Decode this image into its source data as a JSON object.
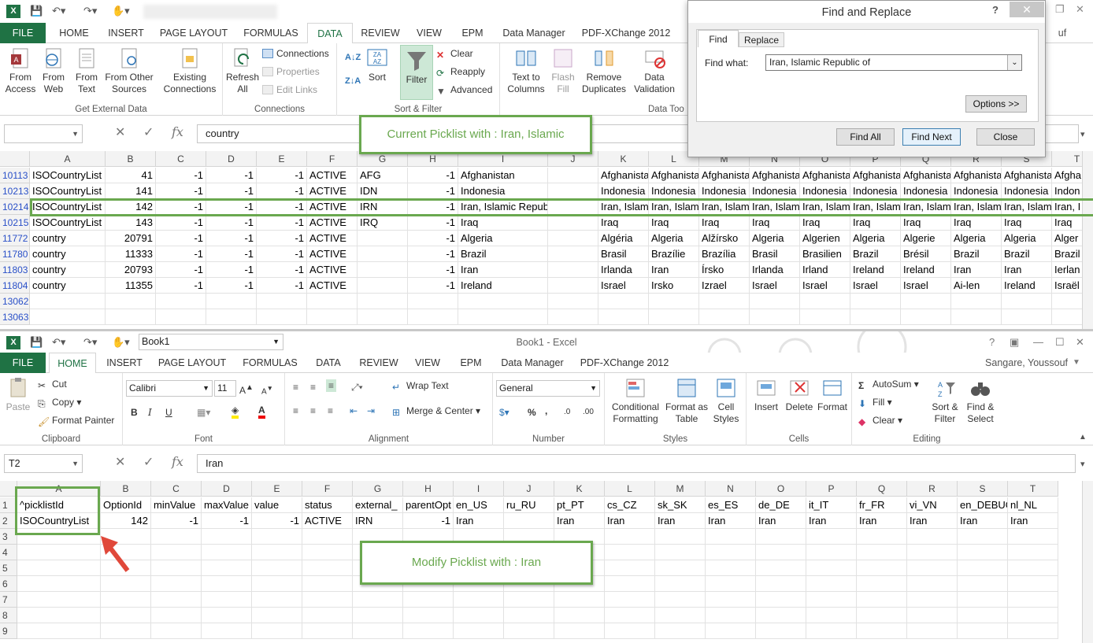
{
  "top_window": {
    "tabs": [
      "FILE",
      "HOME",
      "INSERT",
      "PAGE LAYOUT",
      "FORMULAS",
      "DATA",
      "REVIEW",
      "VIEW",
      "EPM",
      "Data Manager",
      "PDF-XChange 2012"
    ],
    "active_tab": "DATA",
    "user_partial": "uf",
    "ribbon": {
      "get_external": {
        "label": "Get External Data",
        "from_access": "From\nAccess",
        "from_web": "From\nWeb",
        "from_text": "From\nText",
        "from_other": "From Other\nSources",
        "existing": "Existing\nConnections"
      },
      "connections": {
        "label": "Connections",
        "refresh_all": "Refresh\nAll",
        "connections": "Connections",
        "properties": "Properties",
        "edit_links": "Edit Links"
      },
      "sort_filter": {
        "label": "Sort & Filter",
        "sort": "Sort",
        "filter": "Filter",
        "clear": "Clear",
        "reapply": "Reapply",
        "advanced": "Advanced"
      },
      "data_tools": {
        "label": "Data Too",
        "text_to_columns": "Text to\nColumns",
        "flash_fill": "Flash\nFill",
        "remove_duplicates": "Remove\nDuplicates",
        "data_validation": "Data\nValidation"
      }
    },
    "formula": {
      "name_box": "",
      "value": "country"
    },
    "columns": [
      "A",
      "B",
      "C",
      "D",
      "E",
      "F",
      "G",
      "H",
      "I",
      "J",
      "K",
      "L",
      "M",
      "N",
      "O",
      "P",
      "Q",
      "R",
      "S",
      "T"
    ],
    "rows": [
      {
        "num": "10113",
        "cells": [
          "ISOCountryList",
          "41",
          "-1",
          "-1",
          "-1",
          "ACTIVE",
          "AFG",
          "-1",
          "Afghanistan",
          "",
          "Afghanista",
          "Afghanista",
          "Afghanista",
          "Afghanista",
          "Afghanista",
          "Afghanista",
          "Afghanista",
          "Afghanista",
          "Afghanista",
          "Afgha"
        ]
      },
      {
        "num": "10213",
        "cells": [
          "ISOCountryList",
          "141",
          "-1",
          "-1",
          "-1",
          "ACTIVE",
          "IDN",
          "-1",
          "Indonesia",
          "",
          "Indonesia",
          "Indonesia",
          "Indonesia",
          "Indonesia",
          "Indonesia",
          "Indonesia",
          "Indonesia",
          "Indonesia",
          "Indonesia",
          "Indon"
        ]
      },
      {
        "num": "10214",
        "cells": [
          "ISOCountryList",
          "142",
          "-1",
          "-1",
          "-1",
          "ACTIVE",
          "IRN",
          "-1",
          "Iran, Islamic Republic of",
          "",
          "Iran, Islam",
          "Iran, Islam",
          "Iran, Islam",
          "Iran, Islam",
          "Iran, Islam",
          "Iran, Islam",
          "Iran, Islam",
          "Iran, Islam",
          "Iran, Islam",
          "Iran, I"
        ]
      },
      {
        "num": "10215",
        "cells": [
          "ISOCountryList",
          "143",
          "-1",
          "-1",
          "-1",
          "ACTIVE",
          "IRQ",
          "-1",
          "Iraq",
          "",
          "Iraq",
          "Iraq",
          "Iraq",
          "Iraq",
          "Iraq",
          "Iraq",
          "Iraq",
          "Iraq",
          "Iraq",
          "Iraq"
        ]
      },
      {
        "num": "11772",
        "cells": [
          "country",
          "20791",
          "-1",
          "-1",
          "-1",
          "ACTIVE",
          "",
          "-1",
          "Algeria",
          "",
          "Algéria",
          "Algeria",
          "Alžírsko",
          "Algeria",
          "Algerien",
          "Algeria",
          "Algerie",
          "Algeria",
          "Algeria",
          "Alger"
        ]
      },
      {
        "num": "11780",
        "cells": [
          "country",
          "11333",
          "-1",
          "-1",
          "-1",
          "ACTIVE",
          "",
          "-1",
          "Brazil",
          "",
          "Brasil",
          "Brazílie",
          "Brazília",
          "Brasil",
          "Brasilien",
          "Brazil",
          "Brésil",
          "Brazil",
          "Brazil",
          "Brazil"
        ]
      },
      {
        "num": "11803",
        "cells": [
          "country",
          "20793",
          "-1",
          "-1",
          "-1",
          "ACTIVE",
          "",
          "-1",
          "Iran",
          "",
          "Irlanda",
          "Iran",
          "Írsko",
          "Irlanda",
          "Irland",
          "Ireland",
          "Ireland",
          "Iran",
          "Iran",
          "Ierlan"
        ]
      },
      {
        "num": "11804",
        "cells": [
          "country",
          "11355",
          "-1",
          "-1",
          "-1",
          "ACTIVE",
          "",
          "-1",
          "Ireland",
          "",
          "Israel",
          "Irsko",
          "Izrael",
          "Israel",
          "Israel",
          "Israel",
          "Israel",
          "Ai-len",
          "Ireland",
          "Israël"
        ]
      },
      {
        "num": "13062",
        "cells": []
      },
      {
        "num": "13063",
        "cells": []
      }
    ],
    "callout": "Current Picklist with : Iran, Islamic"
  },
  "find_replace": {
    "title": "Find and Replace",
    "help": "?",
    "close": "✕",
    "tab_find": "Find",
    "tab_replace": "Replace",
    "find_what_label": "Find what:",
    "find_what_value": "Iran, Islamic Republic of",
    "options": "Options >>",
    "find_all": "Find All",
    "find_next": "Find Next",
    "close_btn": "Close"
  },
  "bottom_window": {
    "name_box_top": "Book1",
    "title": "Book1 - Excel",
    "user": "Sangare, Youssouf",
    "tabs": [
      "FILE",
      "HOME",
      "INSERT",
      "PAGE LAYOUT",
      "FORMULAS",
      "DATA",
      "REVIEW",
      "VIEW",
      "EPM",
      "Data Manager",
      "PDF-XChange 2012"
    ],
    "active_tab": "HOME",
    "ribbon": {
      "clipboard": {
        "label": "Clipboard",
        "paste": "Paste",
        "cut": "Cut",
        "copy": "Copy",
        "format_painter": "Format Painter"
      },
      "font": {
        "label": "Font",
        "name": "Calibri",
        "size": "11",
        "bold": "B",
        "italic": "I",
        "underline": "U"
      },
      "alignment": {
        "label": "Alignment",
        "wrap_text": "Wrap Text",
        "merge_center": "Merge & Center"
      },
      "number": {
        "label": "Number",
        "format": "General",
        "percent": "%",
        "comma": ","
      },
      "styles": {
        "label": "Styles",
        "conditional": "Conditional\nFormatting",
        "format_table": "Format as\nTable",
        "cell_styles": "Cell\nStyles"
      },
      "cells": {
        "label": "Cells",
        "insert": "Insert",
        "delete": "Delete",
        "format": "Format"
      },
      "editing": {
        "label": "Editing",
        "autosum": "AutoSum",
        "fill": "Fill",
        "clear": "Clear",
        "sort_filter": "Sort &\nFilter",
        "find_select": "Find &\nSelect"
      }
    },
    "formula": {
      "name_box": "T2",
      "value": "Iran"
    },
    "columns": [
      "A",
      "B",
      "C",
      "D",
      "E",
      "F",
      "G",
      "H",
      "I",
      "J",
      "K",
      "L",
      "M",
      "N",
      "O",
      "P",
      "Q",
      "R",
      "S",
      "T"
    ],
    "rows": [
      {
        "num": "1",
        "cells": [
          "^picklistId",
          "OptionId",
          "minValue",
          "maxValue",
          "value",
          "status",
          "external_",
          "parentOpt",
          "en_US",
          "ru_RU",
          "pt_PT",
          "cs_CZ",
          "sk_SK",
          "es_ES",
          "de_DE",
          "it_IT",
          "fr_FR",
          "vi_VN",
          "en_DEBUG",
          "nl_NL"
        ]
      },
      {
        "num": "2",
        "cells": [
          "ISOCountryList",
          "142",
          "-1",
          "-1",
          "-1",
          "ACTIVE",
          "IRN",
          "-1",
          "Iran",
          "",
          "Iran",
          "Iran",
          "Iran",
          "Iran",
          "Iran",
          "Iran",
          "Iran",
          "Iran",
          "Iran",
          "Iran"
        ]
      },
      {
        "num": "3",
        "cells": []
      },
      {
        "num": "4",
        "cells": []
      },
      {
        "num": "5",
        "cells": []
      },
      {
        "num": "6",
        "cells": []
      },
      {
        "num": "7",
        "cells": []
      },
      {
        "num": "8",
        "cells": []
      },
      {
        "num": "9",
        "cells": []
      }
    ],
    "callout": "Modify Picklist with : Iran"
  },
  "colors": {
    "excel_green": "#1f7244",
    "callout_green": "#6aa84f",
    "arrow_red": "#e0483a"
  }
}
